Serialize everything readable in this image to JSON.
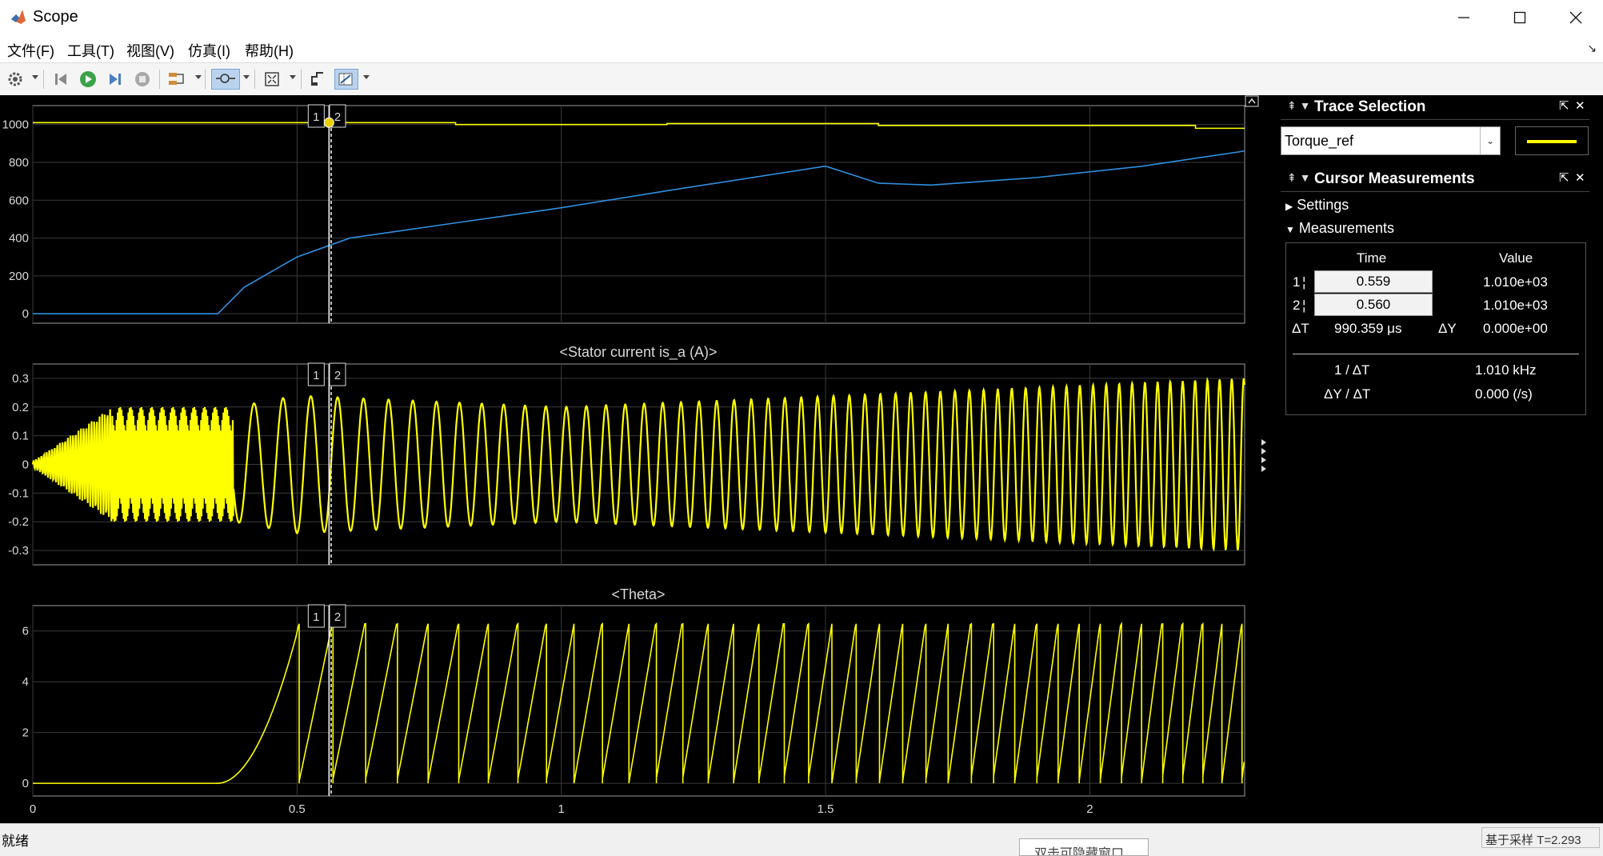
{
  "window": {
    "title": "Scope"
  },
  "menu": [
    "文件(F)",
    "工具(T)",
    "视图(V)",
    "仿真(I)",
    "帮助(H)"
  ],
  "toolbar": {
    "tools": [
      "gear-icon",
      "back-icon",
      "run-icon",
      "step-forward-icon",
      "stop-icon",
      "signal-icon",
      "zoom-icon",
      "fit-icon",
      "style-icon",
      "cursor-icon"
    ]
  },
  "plots": [
    {
      "title": "",
      "yticks": [
        "1000",
        "800",
        "600",
        "400",
        "200",
        "0"
      ]
    },
    {
      "title": "<Stator current is_a (A)>",
      "yticks": [
        "0.3",
        "0.2",
        "0.1",
        "0",
        "-0.1",
        "-0.2",
        "-0.3"
      ]
    },
    {
      "title": "<Theta>",
      "yticks": [
        "6",
        "4",
        "2",
        "0"
      ]
    }
  ],
  "xticks": [
    "0",
    "0.5",
    "1",
    "1.5",
    "2"
  ],
  "cursor_labels": [
    "1",
    "2"
  ],
  "trace_selection": {
    "title": "Trace Selection",
    "selected": "Torque_ref",
    "color": "#ffff00"
  },
  "cursor_measurements": {
    "title": "Cursor Measurements",
    "settings_label": "Settings",
    "measurements_label": "Measurements",
    "col_time": "Time",
    "col_value": "Value",
    "rows": [
      {
        "id": "1",
        "time": "0.559",
        "value": "1.010e+03"
      },
      {
        "id": "2",
        "time": "0.560",
        "value": "1.010e+03"
      }
    ],
    "dt_label": "ΔT",
    "dt_value": "990.359 μs",
    "dy_label": "ΔY",
    "dy_value": "0.000e+00",
    "inv_dt_label": "1 / ΔT",
    "inv_dt_value": "1.010 kHz",
    "dydt_label": "ΔY / ΔT",
    "dydt_value": "0.000 (/s)"
  },
  "status": {
    "left": "就绪",
    "right": "基于采样 T=2.293",
    "tooltip": "双击可隐藏窗口"
  },
  "chart_data": [
    {
      "type": "line",
      "title": "",
      "x_range": [
        0,
        2.293
      ],
      "ylim": [
        -50,
        1100
      ],
      "series": [
        {
          "name": "Torque_ref",
          "color": "#ffff00",
          "x": [
            0,
            0.8,
            0.8,
            1.2,
            1.2,
            1.6,
            1.6,
            2.2,
            2.2,
            2.293
          ],
          "y": [
            1010,
            1010,
            1000,
            1000,
            1005,
            1005,
            995,
            995,
            980,
            980
          ]
        },
        {
          "color": "#2f8fe0",
          "x": [
            0,
            0.35,
            0.4,
            0.5,
            0.6,
            0.8,
            1.0,
            1.2,
            1.5,
            1.6,
            1.7,
            1.9,
            2.1,
            2.293
          ],
          "y": [
            0,
            0,
            140,
            300,
            400,
            480,
            560,
            650,
            780,
            690,
            680,
            720,
            780,
            860
          ]
        }
      ]
    },
    {
      "type": "line",
      "title": "<Stator current is_a (A)>",
      "x_range": [
        0,
        2.293
      ],
      "ylim": [
        -0.35,
        0.35
      ],
      "series": [
        {
          "name": "is_a",
          "color": "#ffff00",
          "amplitude_envelope": [
            [
              0,
              0.01
            ],
            [
              0.15,
              0.2
            ],
            [
              0.38,
              0.2
            ],
            [
              0.5,
              0.24
            ],
            [
              1.0,
              0.2
            ],
            [
              1.8,
              0.26
            ],
            [
              2.293,
              0.3
            ]
          ]
        }
      ]
    },
    {
      "type": "line",
      "title": "<Theta>",
      "x_range": [
        0,
        2.293
      ],
      "ylim": [
        -0.5,
        7
      ],
      "series": [
        {
          "name": "Theta",
          "color": "#ffff00",
          "wrap_at": 6.283,
          "note_sawtooth_starts": 0.35
        }
      ]
    }
  ]
}
